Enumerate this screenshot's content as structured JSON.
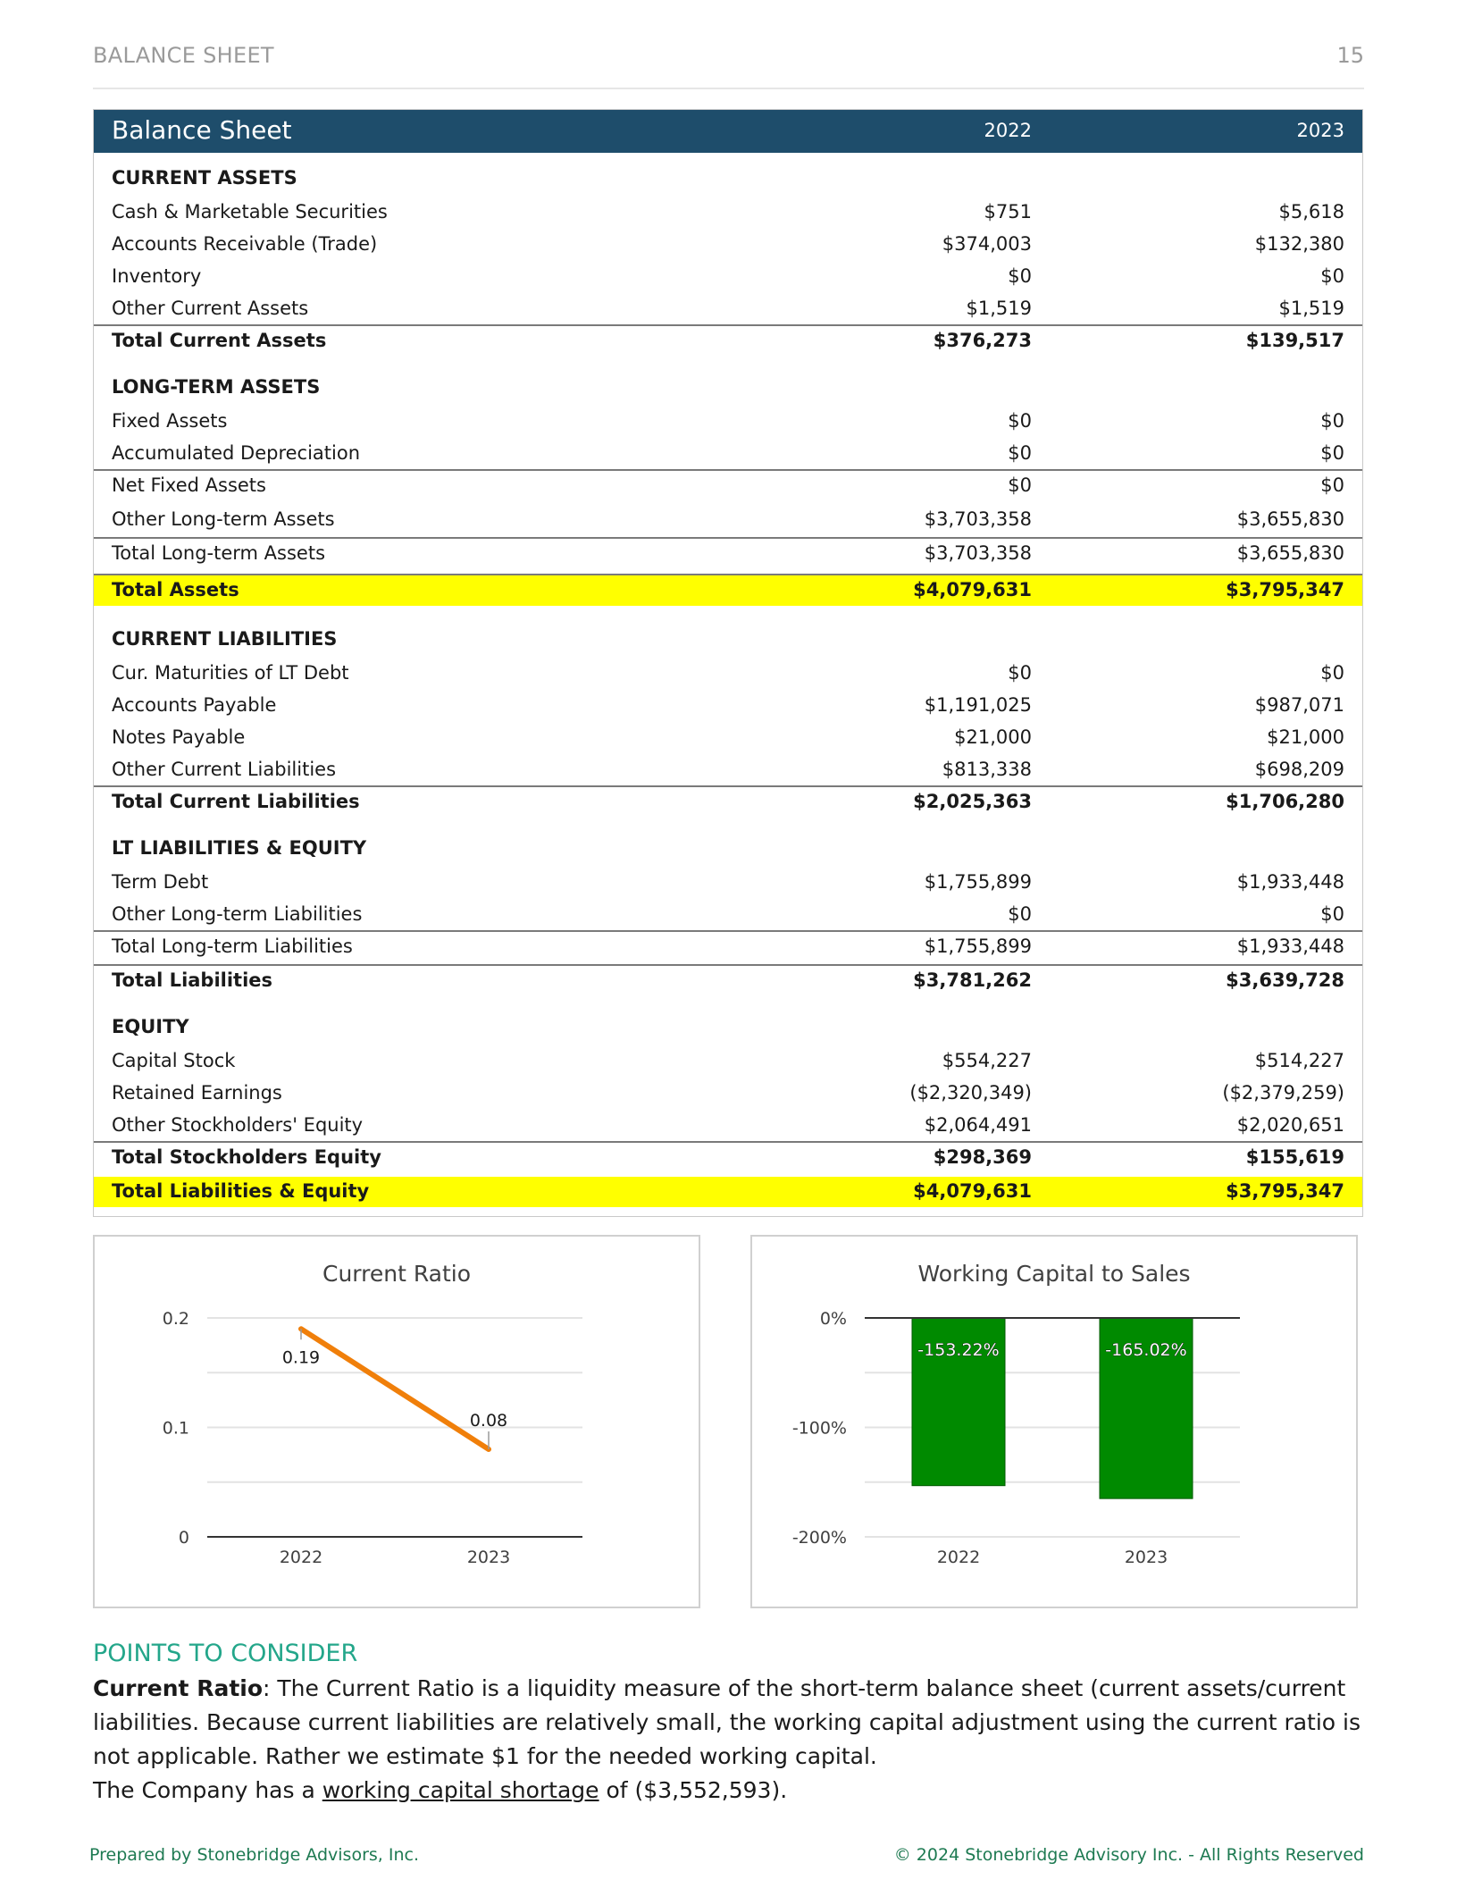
{
  "header": {
    "section": "BALANCE SHEET",
    "page_number": "15"
  },
  "table": {
    "title": "Balance Sheet",
    "year1": "2022",
    "year2": "2023",
    "sections": {
      "current_assets": "CURRENT ASSETS",
      "long_term_assets": "LONG-TERM ASSETS",
      "current_liabilities": "CURRENT LIABILITIES",
      "lt_liabilities_equity": "LT LIABILITIES & EQUITY",
      "equity": "EQUITY"
    },
    "rows": {
      "cash": [
        "Cash & Marketable Securities",
        "$751",
        "$5,618"
      ],
      "ar": [
        "Accounts Receivable (Trade)",
        "$374,003",
        "$132,380"
      ],
      "inventory": [
        "Inventory",
        "$0",
        "$0"
      ],
      "oca": [
        "Other Current Assets",
        "$1,519",
        "$1,519"
      ],
      "tca": [
        "Total Current Assets",
        "$376,273",
        "$139,517"
      ],
      "fixed": [
        "Fixed Assets",
        "$0",
        "$0"
      ],
      "accdep": [
        "Accumulated Depreciation",
        "$0",
        "$0"
      ],
      "netfixed": [
        "Net Fixed Assets",
        "$0",
        "$0"
      ],
      "olta": [
        "Other Long-term Assets",
        "$3,703,358",
        "$3,655,830"
      ],
      "tlta": [
        "Total Long-term Assets",
        "$3,703,358",
        "$3,655,830"
      ],
      "ta": [
        "Total Assets",
        "$4,079,631",
        "$3,795,347"
      ],
      "curmat": [
        "Cur. Maturities of LT Debt",
        "$0",
        "$0"
      ],
      "ap": [
        "Accounts Payable",
        "$1,191,025",
        "$987,071"
      ],
      "np": [
        "Notes Payable",
        "$21,000",
        "$21,000"
      ],
      "ocl": [
        "Other Current Liabilities",
        "$813,338",
        "$698,209"
      ],
      "tcl": [
        "Total Current Liabilities",
        "$2,025,363",
        "$1,706,280"
      ],
      "termdebt": [
        "Term Debt",
        "$1,755,899",
        "$1,933,448"
      ],
      "oltl": [
        "Other Long-term Liabilities",
        "$0",
        "$0"
      ],
      "tltl": [
        "Total Long-term Liabilities",
        "$1,755,899",
        "$1,933,448"
      ],
      "tl": [
        "Total Liabilities",
        "$3,781,262",
        "$3,639,728"
      ],
      "capstock": [
        "Capital Stock",
        "$554,227",
        "$514,227"
      ],
      "retained": [
        "Retained Earnings",
        "($2,320,349)",
        "($2,379,259)"
      ],
      "ose": [
        "Other Stockholders' Equity",
        "$2,064,491",
        "$2,020,651"
      ],
      "tse": [
        "Total Stockholders Equity",
        "$298,369",
        "$155,619"
      ],
      "tle": [
        "Total Liabilities & Equity",
        "$4,079,631",
        "$3,795,347"
      ]
    }
  },
  "chart_data": [
    {
      "type": "line",
      "title": "Current Ratio",
      "categories": [
        "2022",
        "2023"
      ],
      "values": [
        0.19,
        0.08
      ],
      "data_labels": [
        "0.19",
        "0.08"
      ],
      "ylim": [
        0,
        0.2
      ],
      "yticks": [
        "0",
        "0.1",
        "0.2"
      ],
      "color": "#f07f0a",
      "grid": true
    },
    {
      "type": "bar",
      "title": "Working Capital to Sales",
      "categories": [
        "2022",
        "2023"
      ],
      "values": [
        -153.22,
        -165.02
      ],
      "data_labels": [
        "-153.22%",
        "-165.02%"
      ],
      "ylim": [
        -200,
        0
      ],
      "yticks": [
        "0%",
        "-100%",
        "-200%"
      ],
      "color": "#008a00",
      "grid": true
    }
  ],
  "points": {
    "heading": "POINTS TO CONSIDER",
    "cr_label": "Current Ratio",
    "cr_text": ": The Current Ratio is a liquidity measure of the short-term balance sheet (current assets/current liabilities. Because current liabilities are relatively small, the working capital adjustment using the current ratio is not applicable. Rather we estimate $1 for the needed working capital.",
    "line2_pre": "The Company has a ",
    "line2_link": "working capital shortage",
    "line2_post": " of ($3,552,593)."
  },
  "footer": {
    "left": "Prepared by Stonebridge Advisors, Inc.",
    "right": "© 2024 Stonebridge Advisory Inc. - All Rights Reserved"
  }
}
